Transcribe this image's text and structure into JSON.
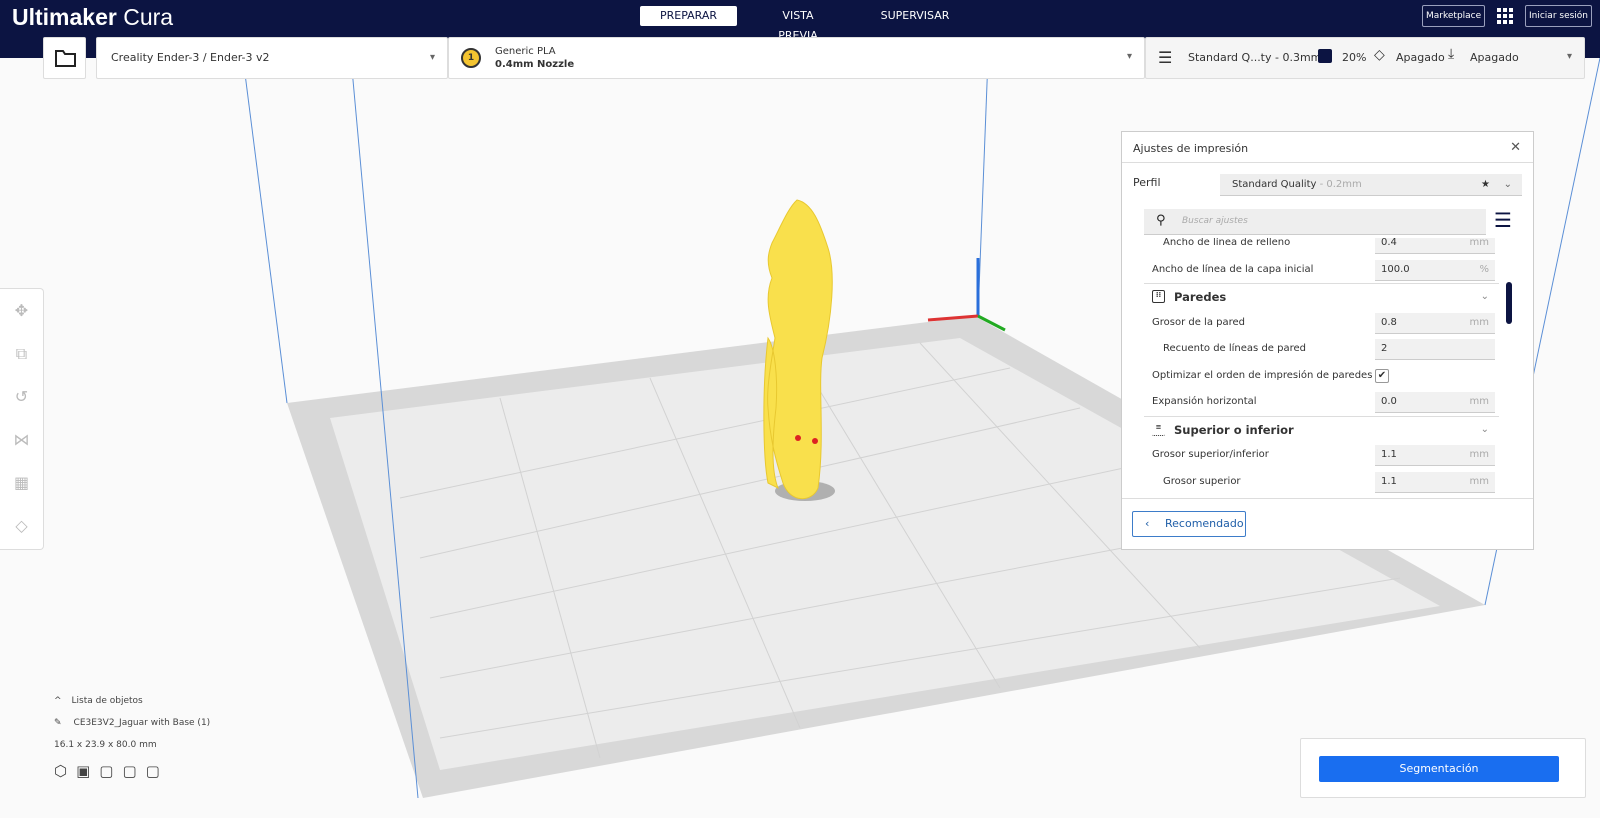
{
  "header": {
    "brand_bold": "Ultimaker",
    "brand_rest": " Cura",
    "tabs": [
      {
        "label": "PREPARAR",
        "active": true
      },
      {
        "label": "VISTA PREVIA"
      },
      {
        "label": "SUPERVISAR"
      }
    ],
    "marketplace": "Marketplace",
    "signin": "Iniciar sesión"
  },
  "config": {
    "printer": "Creality Ender-3 / Ender-3 v2",
    "extruder_number": "1",
    "material": "Generic PLA",
    "nozzle": "0.4mm Nozzle",
    "quality": "Standard Q...ty - 0.3mm",
    "infill": "20%",
    "support": "Apagado",
    "adhesion": "Apagado"
  },
  "panel": {
    "title": "Ajustes de impresión",
    "profile_label": "Perfil",
    "profile_name": "Standard Quality",
    "profile_layer": " - 0.2mm",
    "search_placeholder": "Buscar ajustes",
    "rows_a": [
      {
        "label": "Ancho de línea de relleno",
        "value": "0.4",
        "unit": "mm",
        "sub": true
      },
      {
        "label": "Ancho de línea de la capa inicial",
        "value": "100.0",
        "unit": "%"
      }
    ],
    "cat_walls": "Paredes",
    "rows_b": [
      {
        "label": "Grosor de la pared",
        "value": "0.8",
        "unit": "mm"
      },
      {
        "label": "Recuento de líneas de pared",
        "value": "2",
        "unit": "",
        "sub": true
      }
    ],
    "optimize_label": "Optimizar el orden de impresión de paredes",
    "optimize_checked": true,
    "rows_c": [
      {
        "label": "Expansión horizontal",
        "value": "0.0",
        "unit": "mm"
      }
    ],
    "cat_topbottom": "Superior o inferior",
    "rows_d": [
      {
        "label": "Grosor superior/inferior",
        "value": "1.1",
        "unit": "mm"
      },
      {
        "label": "Grosor superior",
        "value": "1.1",
        "unit": "mm",
        "sub": true
      }
    ],
    "recommended": "Recomendado"
  },
  "objects": {
    "header": "Lista de objetos",
    "name": "CE3E3V2_Jaguar with Base (1)",
    "dimensions": "16.1 x 23.9 x 80.0 mm"
  },
  "slice_label": "Segmentación"
}
